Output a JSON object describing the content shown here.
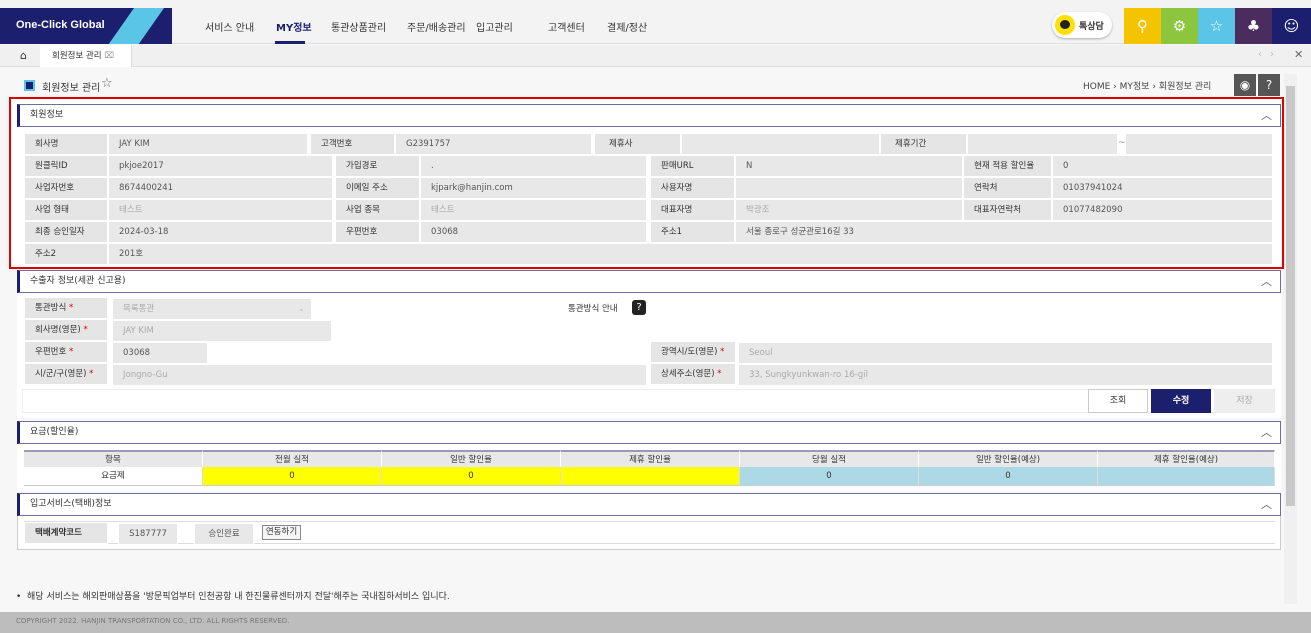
{
  "header": {
    "logo": "One-Click Global",
    "nav": [
      "서비스 안내",
      "MY정보",
      "통관상품관리",
      "주문/배송관리",
      "입고관리",
      "고객센터",
      "결제/정산"
    ],
    "active_nav": "MY정보",
    "kakao_label": "톡상담",
    "icon_buttons": [
      {
        "icon": "search-icon",
        "color": "#f5c400"
      },
      {
        "icon": "settings-icon",
        "color": "#8cc63f"
      },
      {
        "icon": "star-icon",
        "color": "#5bc5e8"
      },
      {
        "icon": "bell-icon",
        "color": "#4a2d5e"
      },
      {
        "icon": "user-icon",
        "color": "#1b1f6e"
      }
    ]
  },
  "tabs": {
    "items": [
      {
        "label": "회원정보 관리"
      }
    ]
  },
  "page": {
    "title": "회원정보 관리",
    "breadcrumb": [
      "HOME",
      "MY정보",
      "회원정보 관리"
    ]
  },
  "member": {
    "title": "회원정보",
    "rows": [
      [
        [
          "회사명",
          "JAY KIM"
        ],
        [
          "고객번호",
          "G2391757"
        ],
        [
          "제휴사",
          ""
        ],
        [
          "제휴기간",
          "",
          "~",
          ""
        ]
      ],
      [
        [
          "원클릭ID",
          "pkjoe2017"
        ],
        [
          "가입경로",
          "."
        ],
        [
          "판매URL",
          "N"
        ],
        [
          "현재 적용 할인율",
          "0"
        ]
      ],
      [
        [
          "사업자번호",
          "8674400241"
        ],
        [
          "이메일 주소",
          "kjpark@hanjin.com"
        ],
        [
          "사용자명",
          ""
        ],
        [
          "연락처",
          "01037941024"
        ]
      ],
      [
        [
          "사업 형태",
          "테스트"
        ],
        [
          "사업 종목",
          "테스트"
        ],
        [
          "대표자명",
          "박광조"
        ],
        [
          "대표자연락처",
          "01077482090"
        ]
      ],
      [
        [
          "최종 승인일자",
          "2024-03-18"
        ],
        [
          "우편번호",
          "03068"
        ],
        [
          "주소1",
          "서울 종로구 성균관로16길 33"
        ]
      ],
      [
        [
          "주소2",
          "201호"
        ]
      ]
    ]
  },
  "exporter": {
    "title": "수출자 정보(세관 신고용)",
    "customs_method_label": "통관방식",
    "customs_method_value": "목록통관",
    "customs_guide": "통관방식 안내",
    "name_en_label": "회사명(영문)",
    "name_en": "JAY KIM",
    "zip_label": "우편번호",
    "zip": "03068",
    "city_label": "광역시/도(영문)",
    "city": "Seoul",
    "district_label": "시/군/구(영문)",
    "district": "Jongno-Gu",
    "detail_label": "상세주소(영문)",
    "detail": "33, Sungkyunkwan-ro 16-gil",
    "buttons": {
      "search": "조회",
      "edit": "수정",
      "save": "저장"
    }
  },
  "fee": {
    "title": "요금(할인율)",
    "headers": [
      "항목",
      "전월 실적",
      "일반 할인율",
      "제휴 할인율",
      "당월 실적",
      "일반 할인율(예상)",
      "제휴 할인율(예상)"
    ],
    "row": [
      "요금제",
      "0",
      "0",
      "",
      "0",
      "0",
      ""
    ],
    "colors": {
      "past": "#ffff00",
      "current": "#add8e6"
    }
  },
  "inbound": {
    "title": "입고서비스(택배)정보",
    "label": "택배계약코드",
    "code": "S187777",
    "status": "승인완료",
    "link_button": "연동하기"
  },
  "notice": "해당 서비스는 해외판매상품을 '방문픽업부터 인천공항 내 한진물류센터까지 전달'해주는 국내집하서비스 입니다.",
  "footer": "COPYRIGHT 2022. HANJIN TRANSPORTATION CO., LTD. ALL RIGHTS RESERVED."
}
